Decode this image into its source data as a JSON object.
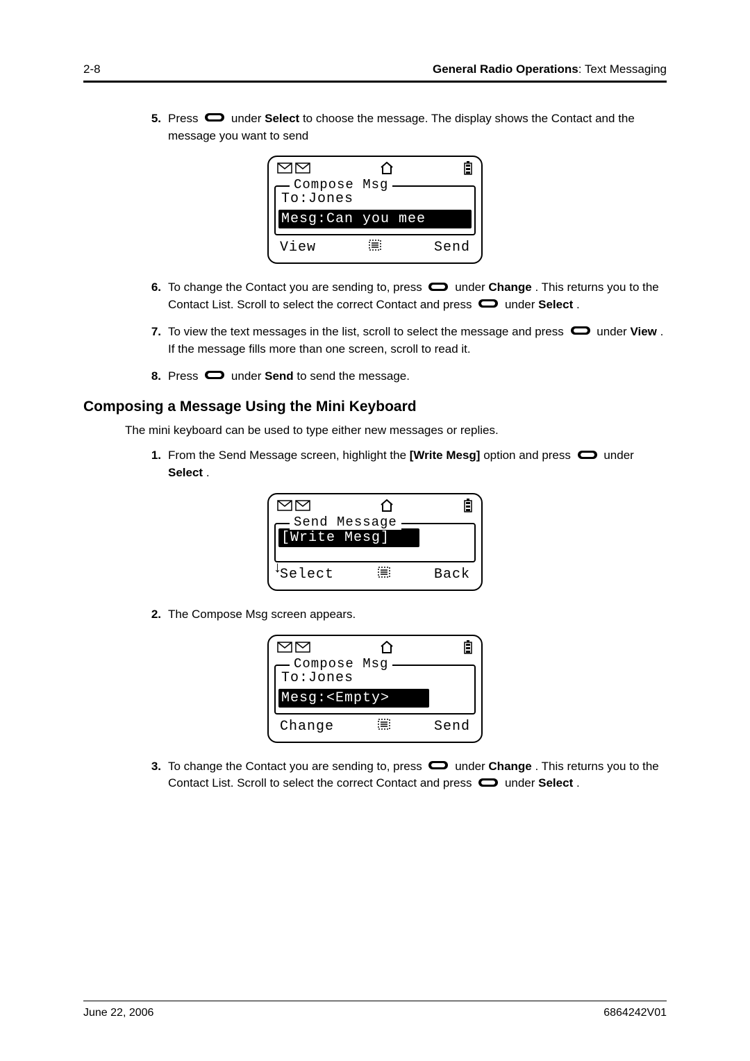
{
  "header": {
    "page_num": "2-8",
    "section_title": "General Radio Operations",
    "subsection": "Text Messaging"
  },
  "steps_a": {
    "s5": {
      "num": "5.",
      "t1": "Press ",
      "t2": " under ",
      "b1": "Select",
      "t3": " to choose the message. The display shows the Contact and the message you want to send"
    },
    "s6": {
      "num": "6.",
      "t1": "To change the Contact you are sending to, press ",
      "t2": " under ",
      "b1": "Change",
      "t3": ". This returns you to the Contact List. Scroll to select the correct Contact and press ",
      "t4": " under ",
      "b2": "Select",
      "t5": "."
    },
    "s7": {
      "num": "7.",
      "t1": "To view the text messages in the list, scroll to select the message and press ",
      "t2": " under ",
      "b1": "View",
      "t3": ". If the message fills more than one screen, scroll to read it."
    },
    "s8": {
      "num": "8.",
      "t1": "Press ",
      "t2": " under ",
      "b1": "Send",
      "t3": " to send the message."
    }
  },
  "heading2": "Composing a Message Using the Mini Keyboard",
  "intro": "The mini keyboard can be used to type either new messages or replies.",
  "steps_b": {
    "s1": {
      "num": "1.",
      "t1": "From the Send Message screen, highlight the ",
      "b1": "[Write Mesg]",
      "t2": " option and press ",
      "t3": " under ",
      "b2": "Select",
      "t4": " ."
    },
    "s2": {
      "num": "2.",
      "t1": "The Compose Msg screen appears."
    },
    "s3": {
      "num": "3.",
      "t1": "To change the Contact you are sending to, press ",
      "t2": " under ",
      "b1": "Change",
      "t3": ". This returns you to the Contact List. Scroll to select the correct Contact and press ",
      "t4": " under ",
      "b2": "Select",
      "t5": "."
    }
  },
  "lcd1": {
    "title": "Compose Msg",
    "line1": "To:Jones",
    "line2": "Mesg:Can you mee",
    "soft_left": "View",
    "soft_right": "Send"
  },
  "lcd2": {
    "title": "Send Message",
    "line1": "[Write Mesg]",
    "soft_left": "Select",
    "soft_right": "Back"
  },
  "lcd3": {
    "title": "Compose Msg",
    "line1": "To:Jones",
    "line2": "Mesg:<Empty>",
    "soft_left": "Change",
    "soft_right": "Send"
  },
  "footer": {
    "date": "June 22, 2006",
    "doc_num": "6864242V01"
  }
}
